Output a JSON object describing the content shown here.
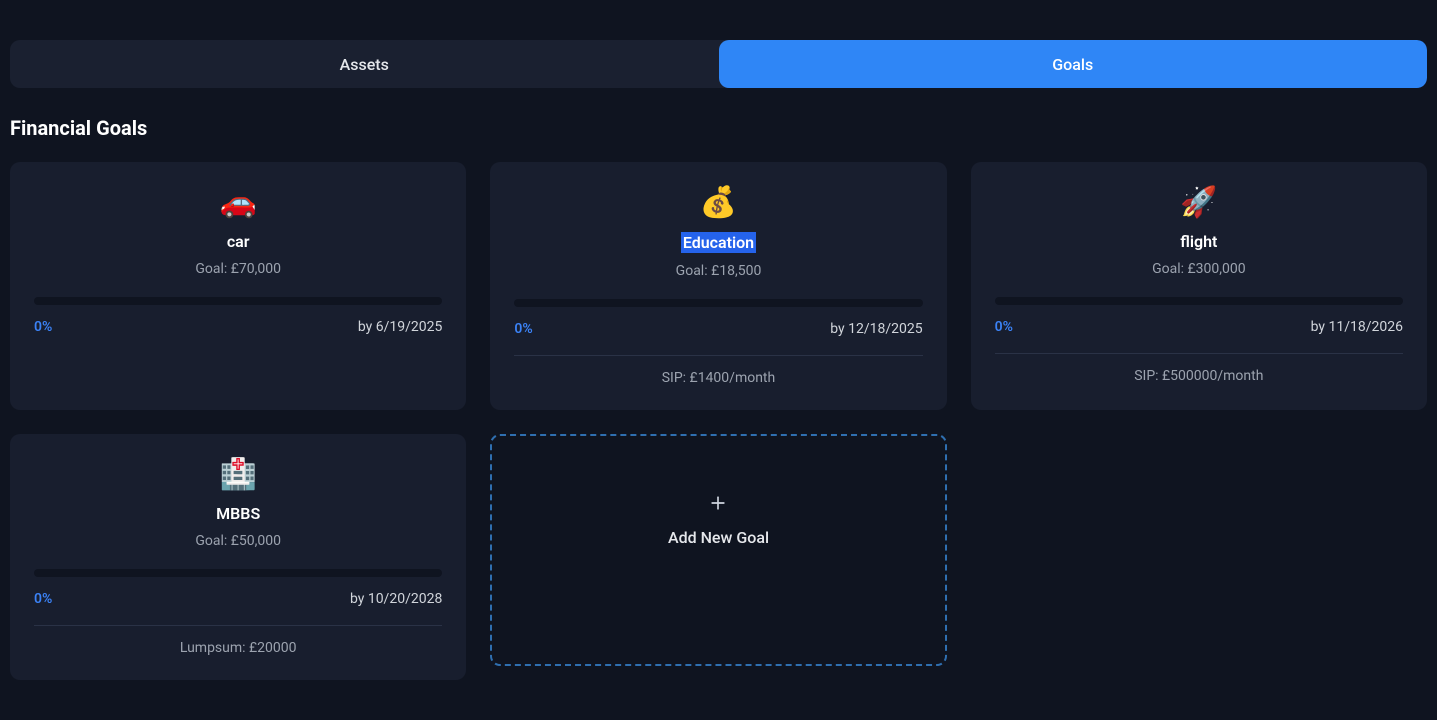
{
  "tabs": {
    "assets": "Assets",
    "goals": "Goals",
    "active": "goals"
  },
  "section_title": "Financial Goals",
  "goals": [
    {
      "icon": "🚗",
      "name": "car",
      "amount_label": "Goal: £70,000",
      "progress_pct": "0%",
      "by_date": "by 6/19/2025",
      "footer": null,
      "selected": false
    },
    {
      "icon": "💰",
      "name": "Education",
      "amount_label": "Goal: £18,500",
      "progress_pct": "0%",
      "by_date": "by 12/18/2025",
      "footer": "SIP: £1400/month",
      "selected": true
    },
    {
      "icon": "🚀",
      "name": "flight",
      "amount_label": "Goal: £300,000",
      "progress_pct": "0%",
      "by_date": "by 11/18/2026",
      "footer": "SIP: £500000/month",
      "selected": false
    },
    {
      "icon": "🏥",
      "name": "MBBS",
      "amount_label": "Goal: £50,000",
      "progress_pct": "0%",
      "by_date": "by 10/20/2028",
      "footer": "Lumpsum: £20000",
      "selected": false
    }
  ],
  "add_goal_label": "Add New Goal"
}
